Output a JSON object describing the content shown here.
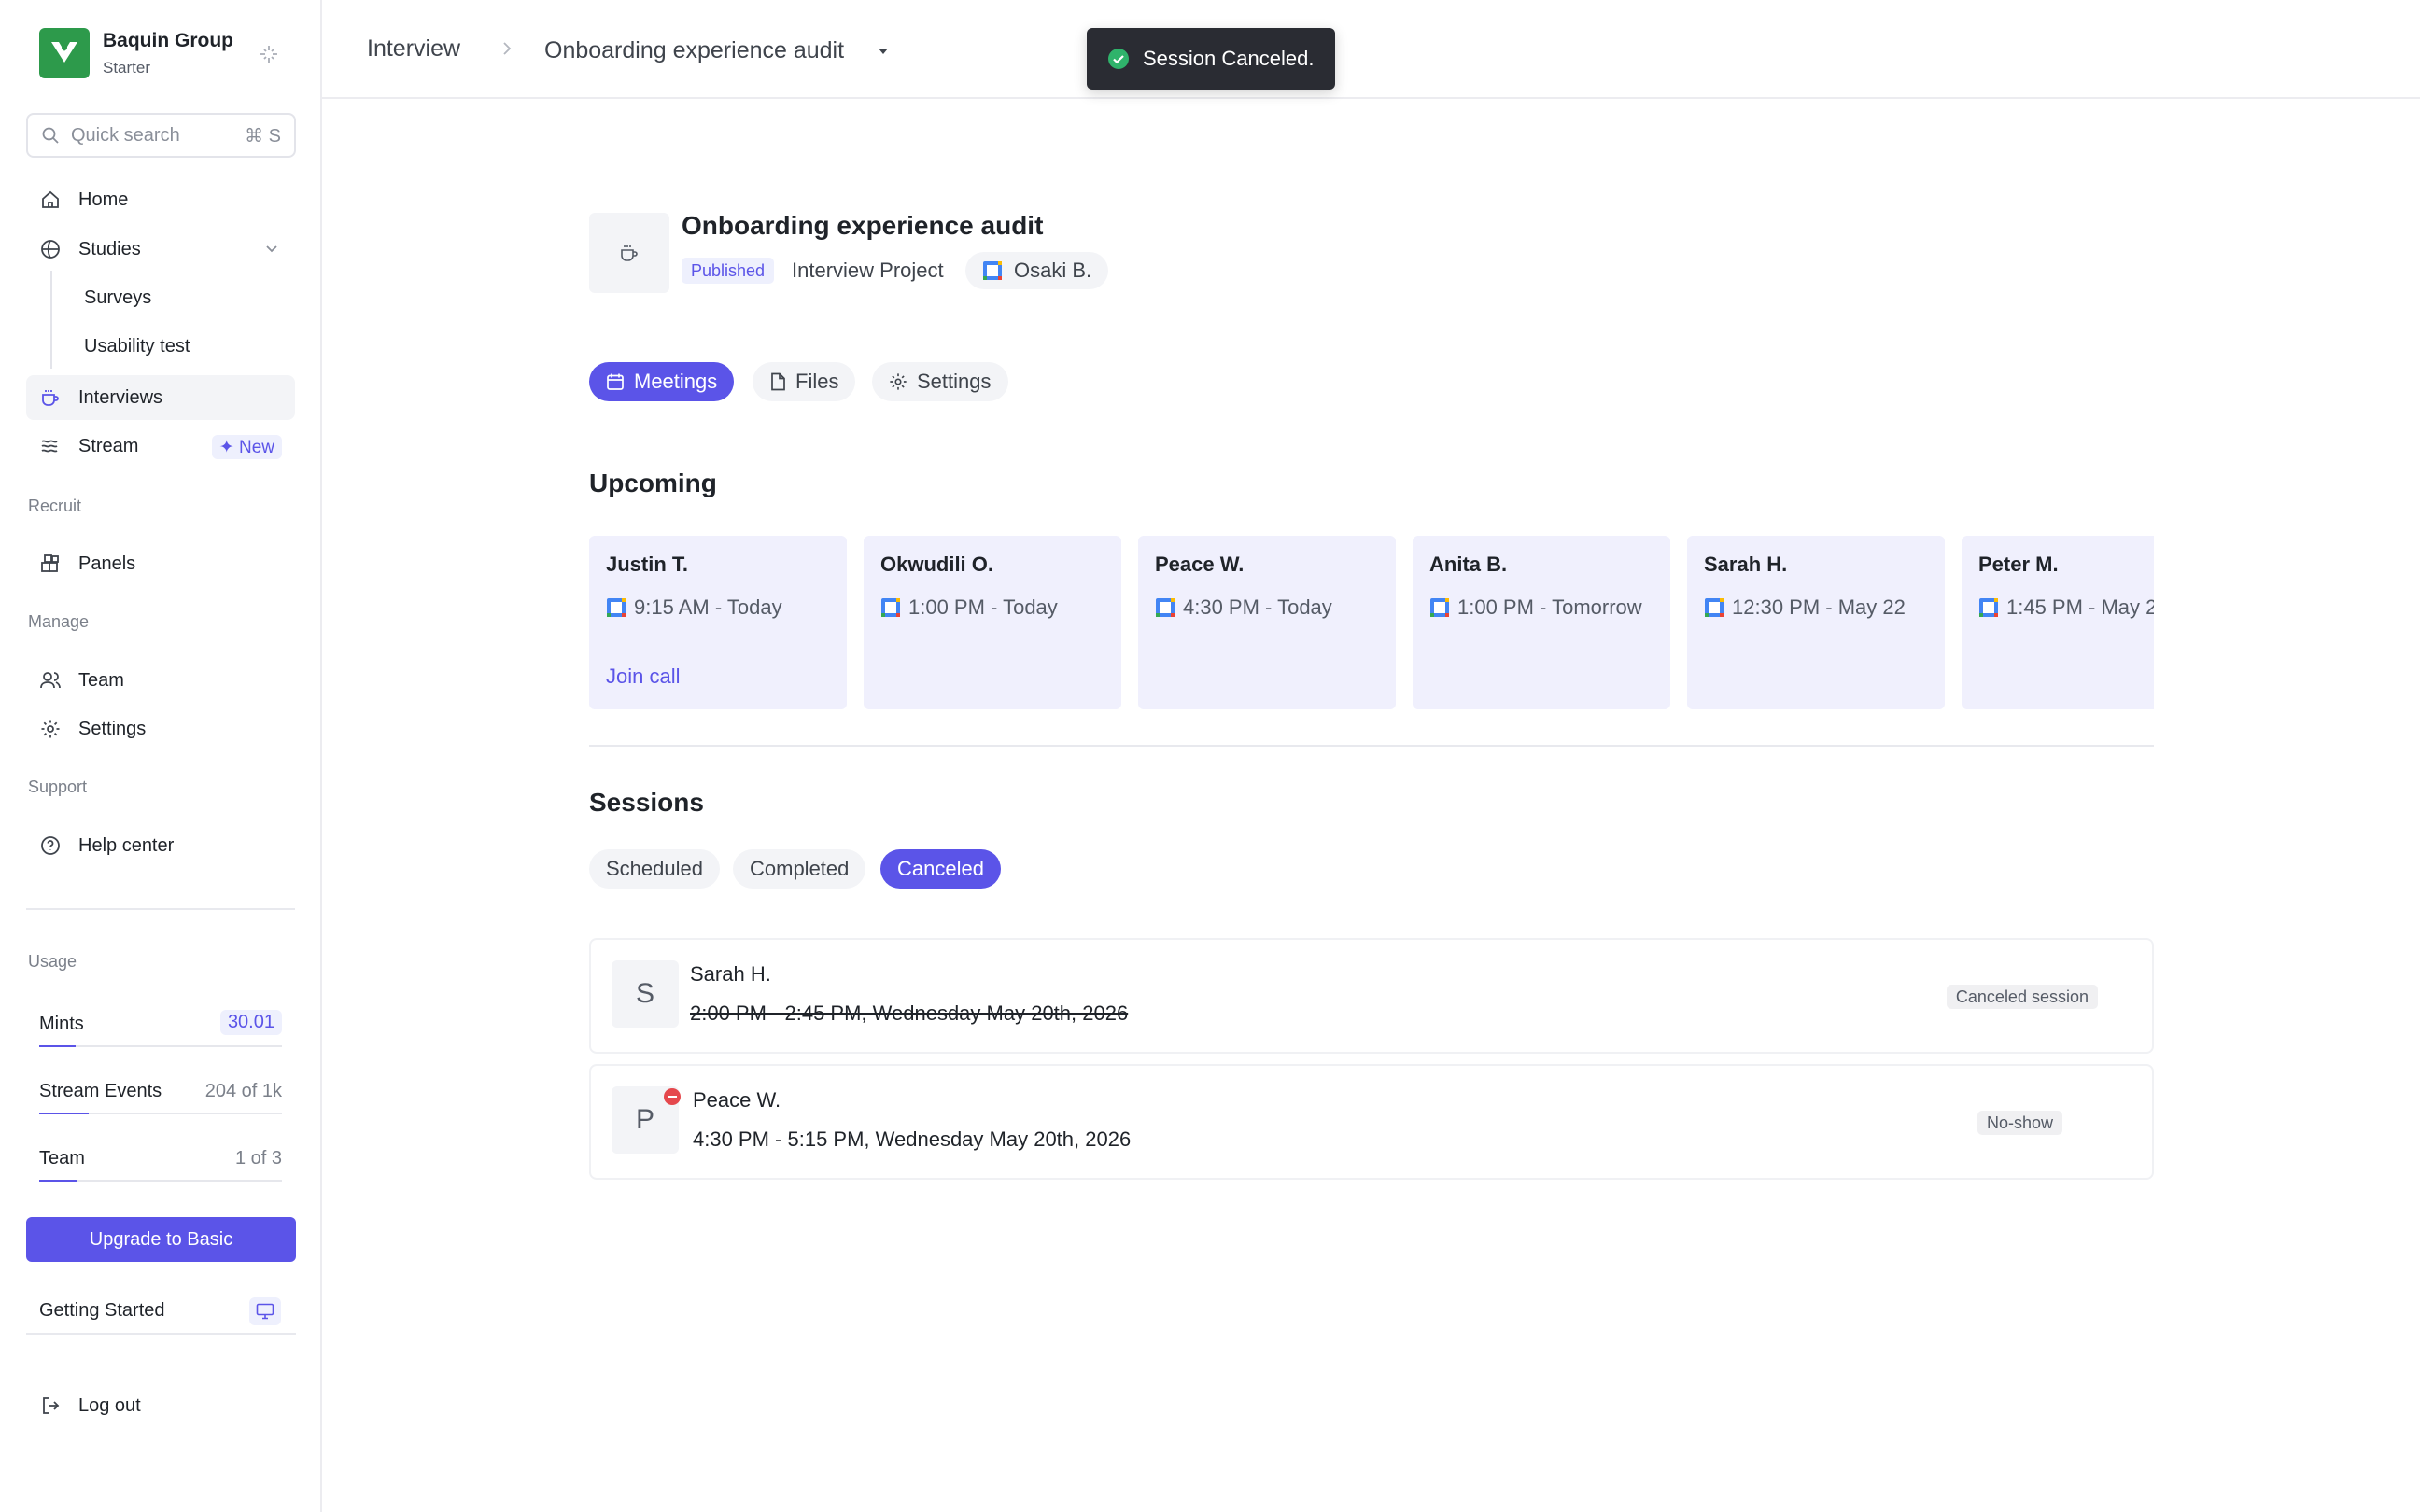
{
  "brand": {
    "name": "Baquin Group",
    "plan": "Starter"
  },
  "search": {
    "placeholder": "Quick search",
    "shortcut": "⌘ S"
  },
  "nav": {
    "home": "Home",
    "studies": "Studies",
    "surveys": "Surveys",
    "usability": "Usability test",
    "interviews": "Interviews",
    "stream": "Stream",
    "stream_badge": "✦ New",
    "recruit_label": "Recruit",
    "panels": "Panels",
    "manage_label": "Manage",
    "team": "Team",
    "settings": "Settings",
    "support_label": "Support",
    "help": "Help center",
    "logout": "Log out"
  },
  "usage": {
    "label": "Usage",
    "items": [
      {
        "name": "Mints",
        "value": "30.01",
        "fraction": 0.15
      },
      {
        "name": "Stream Events",
        "value": "204 of 1k",
        "fraction": 0.204
      },
      {
        "name": "Team",
        "value": "1 of 3",
        "fraction": 0.153
      }
    ]
  },
  "upgrade_label": "Upgrade to Basic",
  "getting_started": "Getting Started",
  "breadcrumb": {
    "root": "Interview",
    "current": "Onboarding experience audit"
  },
  "toast": {
    "message": "Session Canceled."
  },
  "project": {
    "title": "Onboarding experience audit",
    "status": "Published",
    "type": "Interview Project",
    "owner": "Osaki B."
  },
  "tabs": [
    {
      "label": "Meetings",
      "active": true
    },
    {
      "label": "Files",
      "active": false
    },
    {
      "label": "Settings",
      "active": false
    }
  ],
  "upcoming": {
    "heading": "Upcoming",
    "join_label": "Join call",
    "cards": [
      {
        "name": "Justin T.",
        "time": "9:15 AM  -  Today"
      },
      {
        "name": "Okwudili O.",
        "time": "1:00 PM  -  Today"
      },
      {
        "name": "Peace W.",
        "time": "4:30 PM  -  Today"
      },
      {
        "name": "Anita B.",
        "time": "1:00 PM  -  Tomorrow"
      },
      {
        "name": "Sarah H.",
        "time": "12:30 PM  -  May 22"
      },
      {
        "name": "Peter M.",
        "time": "1:45 PM  -  May 2"
      }
    ]
  },
  "sessions": {
    "heading": "Sessions",
    "filters": [
      {
        "label": "Scheduled",
        "active": false
      },
      {
        "label": "Completed",
        "active": false
      },
      {
        "label": "Canceled",
        "active": true
      }
    ],
    "rows": [
      {
        "initial": "S",
        "name": "Sarah H.",
        "time": "2:00 PM - 2:45 PM, Wednesday May 20th, 2026",
        "badge": "Canceled session"
      },
      {
        "initial": "P",
        "name": "Peace W.",
        "time": "4:30 PM - 5:15 PM, Wednesday May 20th, 2026",
        "badge": "No-show"
      }
    ]
  },
  "colors": {
    "accent": "#5b54e8",
    "brand": "#2d9a4b",
    "toast": "#2a2c33",
    "success": "#2fb36b",
    "danger": "#e5484d"
  }
}
